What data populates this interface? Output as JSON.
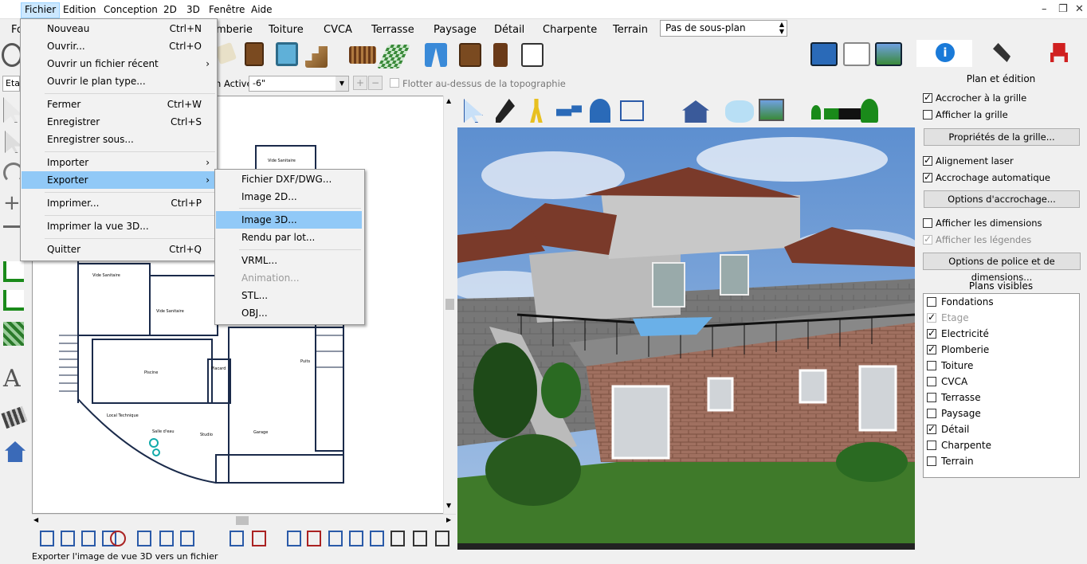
{
  "menubar": {
    "items": [
      "Fichier",
      "Edition",
      "Conception",
      "2D",
      "3D",
      "Fenêtre",
      "Aide"
    ]
  },
  "window": {
    "minimize": "–",
    "restore": "❐",
    "close": "✕"
  },
  "tabs": [
    "Fo",
    "mberie",
    "Toiture",
    "CVCA",
    "Terrasse",
    "Paysage",
    "Détail",
    "Charpente",
    "Terrain"
  ],
  "subplan_select": "Pas de sous-plan",
  "optbar": {
    "left_label": "Eta",
    "level_label": "n Active:",
    "level_value": "-6\"",
    "float_label": "Flotter au-dessus de la topographie"
  },
  "file_menu": {
    "items": [
      {
        "label": "Nouveau",
        "shortcut": "Ctrl+N"
      },
      {
        "label": "Ouvrir...",
        "shortcut": "Ctrl+O"
      },
      {
        "label": "Ouvrir un fichier récent",
        "shortcut": "›"
      },
      {
        "label": "Ouvrir le plan type...",
        "shortcut": ""
      },
      {
        "label": "Fermer",
        "shortcut": "Ctrl+W"
      },
      {
        "label": "Enregistrer",
        "shortcut": "Ctrl+S"
      },
      {
        "label": "Enregistrer sous...",
        "shortcut": ""
      },
      {
        "label": "Importer",
        "shortcut": "›"
      },
      {
        "label": "Exporter",
        "shortcut": "›"
      },
      {
        "label": "Imprimer...",
        "shortcut": "Ctrl+P"
      },
      {
        "label": "Imprimer la vue 3D...",
        "shortcut": ""
      },
      {
        "label": "Quitter",
        "shortcut": "Ctrl+Q"
      }
    ]
  },
  "export_menu": {
    "items": [
      "Fichier DXF/DWG...",
      "Image 2D...",
      "Image 3D...",
      "Rendu par lot...",
      "VRML...",
      "Animation...",
      "STL...",
      "OBJ..."
    ]
  },
  "plan_labels": [
    "Vide Sanitaire",
    "Vide Sanitaire",
    "Vide Sanitaire",
    "Piscine",
    "Local Technique",
    "Salle d'eau",
    "Studio",
    "Garage",
    "Placard",
    "Puits"
  ],
  "right_panel": {
    "title": "Plan et édition",
    "snap_grid": "Accrocher à la grille",
    "show_grid": "Afficher la grille",
    "grid_props": "Propriétés de la grille...",
    "laser": "Alignement laser",
    "auto_snap": "Accrochage automatique",
    "snap_opts": "Options d'accrochage...",
    "show_dims": "Afficher les dimensions",
    "show_legends": "Afficher les légendes",
    "font_opts": "Options de police et de dimensions...",
    "visible_title": "Plans visibles",
    "layers": [
      {
        "name": "Fondations",
        "checked": false
      },
      {
        "name": "Etage",
        "checked": true,
        "disabled": true
      },
      {
        "name": "Electricité",
        "checked": true
      },
      {
        "name": "Plomberie",
        "checked": true
      },
      {
        "name": "Toiture",
        "checked": false
      },
      {
        "name": "CVCA",
        "checked": false
      },
      {
        "name": "Terrasse",
        "checked": false
      },
      {
        "name": "Paysage",
        "checked": false
      },
      {
        "name": "Détail",
        "checked": true
      },
      {
        "name": "Charpente",
        "checked": false
      },
      {
        "name": "Terrain",
        "checked": false
      }
    ]
  },
  "status": "Exporter l'image de vue 3D vers un fichier",
  "colors": {
    "accent": "#0078d7",
    "highlight": "#91c9f7",
    "roof": "#7a3a2a",
    "sky": "#6f9ad4",
    "grass": "#3f7a2a"
  }
}
